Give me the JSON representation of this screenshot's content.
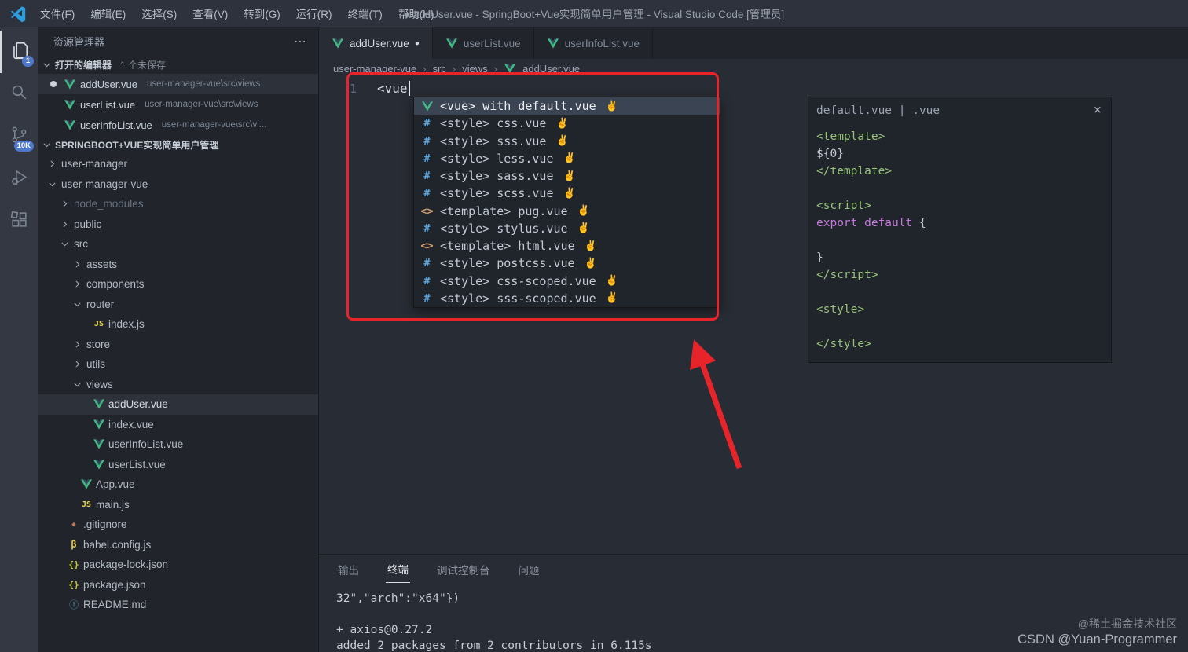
{
  "titlebar": {
    "menus": [
      "文件(F)",
      "编辑(E)",
      "选择(S)",
      "查看(V)",
      "转到(G)",
      "运行(R)",
      "终端(T)",
      "帮助(H)"
    ],
    "title": "● addUser.vue - SpringBoot+Vue实现简单用户管理 - Visual Studio Code [管理员]"
  },
  "activitybar": {
    "items": [
      {
        "name": "explorer",
        "badge": "1",
        "active": true
      },
      {
        "name": "search"
      },
      {
        "name": "source-control",
        "badge": "10K"
      },
      {
        "name": "run-debug"
      },
      {
        "name": "extensions"
      }
    ]
  },
  "sidebar": {
    "title": "资源管理器",
    "more_actions": "⋯",
    "open_editors_header": "打开的编辑器",
    "open_editors_badge": "1 个未保存",
    "open_editors": [
      {
        "label": "addUser.vue",
        "path": "user-manager-vue\\src\\views",
        "modified": true,
        "selected": true
      },
      {
        "label": "userList.vue",
        "path": "user-manager-vue\\src\\views"
      },
      {
        "label": "userInfoList.vue",
        "path": "user-manager-vue\\src\\vi..."
      }
    ],
    "project_header": "SPRINGBOOT+VUE实现简单用户管理",
    "tree": [
      {
        "label": "user-manager",
        "level": 0,
        "kind": "folder",
        "state": "collapsed"
      },
      {
        "label": "user-manager-vue",
        "level": 0,
        "kind": "folder",
        "state": "expanded"
      },
      {
        "label": "node_modules",
        "level": 1,
        "kind": "folder",
        "state": "collapsed",
        "dim": true
      },
      {
        "label": "public",
        "level": 1,
        "kind": "folder",
        "state": "collapsed"
      },
      {
        "label": "src",
        "level": 1,
        "kind": "folder",
        "state": "expanded"
      },
      {
        "label": "assets",
        "level": 2,
        "kind": "folder",
        "state": "collapsed"
      },
      {
        "label": "components",
        "level": 2,
        "kind": "folder",
        "state": "collapsed"
      },
      {
        "label": "router",
        "level": 2,
        "kind": "folder",
        "state": "expanded"
      },
      {
        "label": "index.js",
        "level": 3,
        "kind": "js"
      },
      {
        "label": "store",
        "level": 2,
        "kind": "folder",
        "state": "collapsed"
      },
      {
        "label": "utils",
        "level": 2,
        "kind": "folder",
        "state": "collapsed"
      },
      {
        "label": "views",
        "level": 2,
        "kind": "folder",
        "state": "expanded"
      },
      {
        "label": "addUser.vue",
        "level": 3,
        "kind": "vue",
        "selected": true
      },
      {
        "label": "index.vue",
        "level": 3,
        "kind": "vue"
      },
      {
        "label": "userInfoList.vue",
        "level": 3,
        "kind": "vue"
      },
      {
        "label": "userList.vue",
        "level": 3,
        "kind": "vue"
      },
      {
        "label": "App.vue",
        "level": 2,
        "kind": "vue"
      },
      {
        "label": "main.js",
        "level": 2,
        "kind": "js"
      },
      {
        "label": ".gitignore",
        "level": 1,
        "kind": "git"
      },
      {
        "label": "babel.config.js",
        "level": 1,
        "kind": "babel"
      },
      {
        "label": "package-lock.json",
        "level": 1,
        "kind": "json"
      },
      {
        "label": "package.json",
        "level": 1,
        "kind": "json"
      },
      {
        "label": "README.md",
        "level": 1,
        "kind": "info"
      }
    ]
  },
  "editor": {
    "tabs": [
      {
        "label": "addUser.vue",
        "active": true,
        "modified": true
      },
      {
        "label": "userList.vue",
        "active": false
      },
      {
        "label": "userInfoList.vue",
        "active": false
      }
    ],
    "breadcrumb": [
      "user-manager-vue",
      "src",
      "views",
      "addUser.vue"
    ],
    "line_number": "1",
    "code_text": "<vue",
    "suggest_items": [
      {
        "icon": "vue",
        "label": "<vue> with default.vue",
        "suffix": "✌️",
        "selected": true
      },
      {
        "icon": "style",
        "label": "<style> css.vue",
        "suffix": "✌️"
      },
      {
        "icon": "style",
        "label": "<style> sss.vue",
        "suffix": "✌️"
      },
      {
        "icon": "style",
        "label": "<style> less.vue",
        "suffix": "✌️"
      },
      {
        "icon": "style",
        "label": "<style> sass.vue",
        "suffix": "✌️"
      },
      {
        "icon": "style",
        "label": "<style> scss.vue",
        "suffix": "✌️"
      },
      {
        "icon": "template",
        "label": "<template> pug.vue",
        "suffix": "✌️"
      },
      {
        "icon": "style",
        "label": "<style> stylus.vue",
        "suffix": "✌️"
      },
      {
        "icon": "template",
        "label": "<template> html.vue",
        "suffix": "✌️"
      },
      {
        "icon": "style",
        "label": "<style> postcss.vue",
        "suffix": "✌️"
      },
      {
        "icon": "style",
        "label": "<style> css-scoped.vue",
        "suffix": "✌️"
      },
      {
        "icon": "style",
        "label": "<style> sss-scoped.vue",
        "suffix": "✌️"
      }
    ],
    "doc_panel": {
      "title": "default.vue | .vue",
      "close": "×",
      "lines": [
        {
          "segs": [
            {
              "t": "<template>",
              "c": "tag"
            }
          ]
        },
        {
          "segs": [
            {
              "t": "  ${0}",
              "c": "plain"
            }
          ]
        },
        {
          "segs": [
            {
              "t": "</template>",
              "c": "tag"
            }
          ]
        },
        {
          "segs": []
        },
        {
          "segs": [
            {
              "t": "<script>",
              "c": "tag"
            }
          ]
        },
        {
          "segs": [
            {
              "t": "export default",
              "c": "kw"
            },
            {
              "t": " {",
              "c": "plain"
            }
          ]
        },
        {
          "segs": []
        },
        {
          "segs": [
            {
              "t": "}",
              "c": "plain"
            }
          ]
        },
        {
          "segs": [
            {
              "t": "</script>",
              "c": "tag"
            }
          ]
        },
        {
          "segs": []
        },
        {
          "segs": [
            {
              "t": "<style>",
              "c": "tag"
            }
          ]
        },
        {
          "segs": []
        },
        {
          "segs": [
            {
              "t": "</style>",
              "c": "tag"
            }
          ]
        }
      ]
    }
  },
  "panel": {
    "tabs": [
      {
        "label": "输出",
        "active": false
      },
      {
        "label": "终端",
        "active": true
      },
      {
        "label": "调试控制台",
        "active": false
      },
      {
        "label": "问题",
        "active": false
      }
    ],
    "terminal_lines": [
      "32\",\"arch\":\"x64\"})",
      "",
      "+ axios@0.27.2",
      "added 2 packages from 2 contributors in 6.115s"
    ]
  },
  "watermark": {
    "line1": "@稀土掘金技术社区",
    "line2": "CSDN @Yuan-Programmer"
  },
  "annotation": {
    "color": "#e8242b"
  }
}
